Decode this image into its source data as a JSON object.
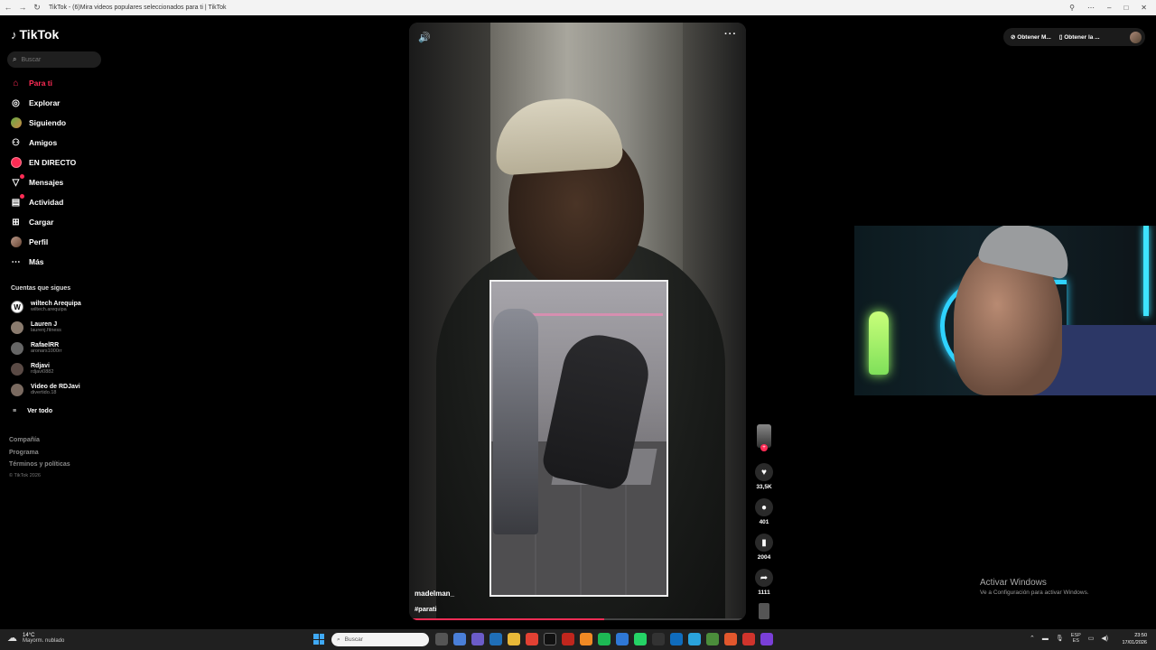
{
  "browser": {
    "tab_title": "TikTok - (6)Mira videos populares seleccionados para ti | TikTok",
    "back": "←",
    "forward": "→",
    "reload": "↻"
  },
  "sidebar": {
    "logo": "TikTok",
    "search_placeholder": "Buscar",
    "items": [
      {
        "label": "Para ti",
        "icon": "home-icon"
      },
      {
        "label": "Explorar",
        "icon": "compass-icon"
      },
      {
        "label": "Siguiendo",
        "icon": "following-avatar-icon"
      },
      {
        "label": "Amigos",
        "icon": "friends-icon"
      },
      {
        "label": "EN DIRECTO",
        "icon": "live-icon"
      },
      {
        "label": "Mensajes",
        "icon": "messages-icon"
      },
      {
        "label": "Actividad",
        "icon": "activity-icon"
      },
      {
        "label": "Cargar",
        "icon": "upload-icon"
      },
      {
        "label": "Perfil",
        "icon": "profile-avatar-icon"
      },
      {
        "label": "Más",
        "icon": "more-icon"
      }
    ],
    "following_title": "Cuentas que sigues",
    "accounts": [
      {
        "name": "wiltech Arequipa",
        "handle": "wiltech.arequipa",
        "initial": "W"
      },
      {
        "name": "Lauren J",
        "handle": "laurenj.fitness",
        "initial": ""
      },
      {
        "name": "RafaelRR",
        "handle": "aronars1000rr",
        "initial": ""
      },
      {
        "name": "Rdjavi",
        "handle": "rdjavi0882",
        "initial": ""
      },
      {
        "name": "Video de RDJavi",
        "handle": "divertido.18",
        "initial": ""
      }
    ],
    "see_all": "Ver todo",
    "footer_links": [
      "Compañía",
      "Programa",
      "Términos y políticas"
    ],
    "copyright": "© TikTok 2026"
  },
  "video": {
    "username": "madelman_",
    "hashtag": "#parati",
    "progress": 0.58,
    "likes": "33,5K",
    "comments": "401",
    "saves": "2004",
    "shares": "1111"
  },
  "topright": {
    "btn1": "Obtener M...",
    "btn2": "Obtener la ..."
  },
  "watermark": {
    "line1": "Activar Windows",
    "line2": "Ve a Configuración para activar Windows."
  },
  "taskbar": {
    "weather_temp": "14°C",
    "weather_desc": "Mayorm. nublado",
    "search_placeholder": "Buscar",
    "lang1": "ESP",
    "lang2": "ES",
    "time": "23:50",
    "date": "17/01/2026"
  },
  "colors": {
    "accent": "#fe2c55"
  }
}
